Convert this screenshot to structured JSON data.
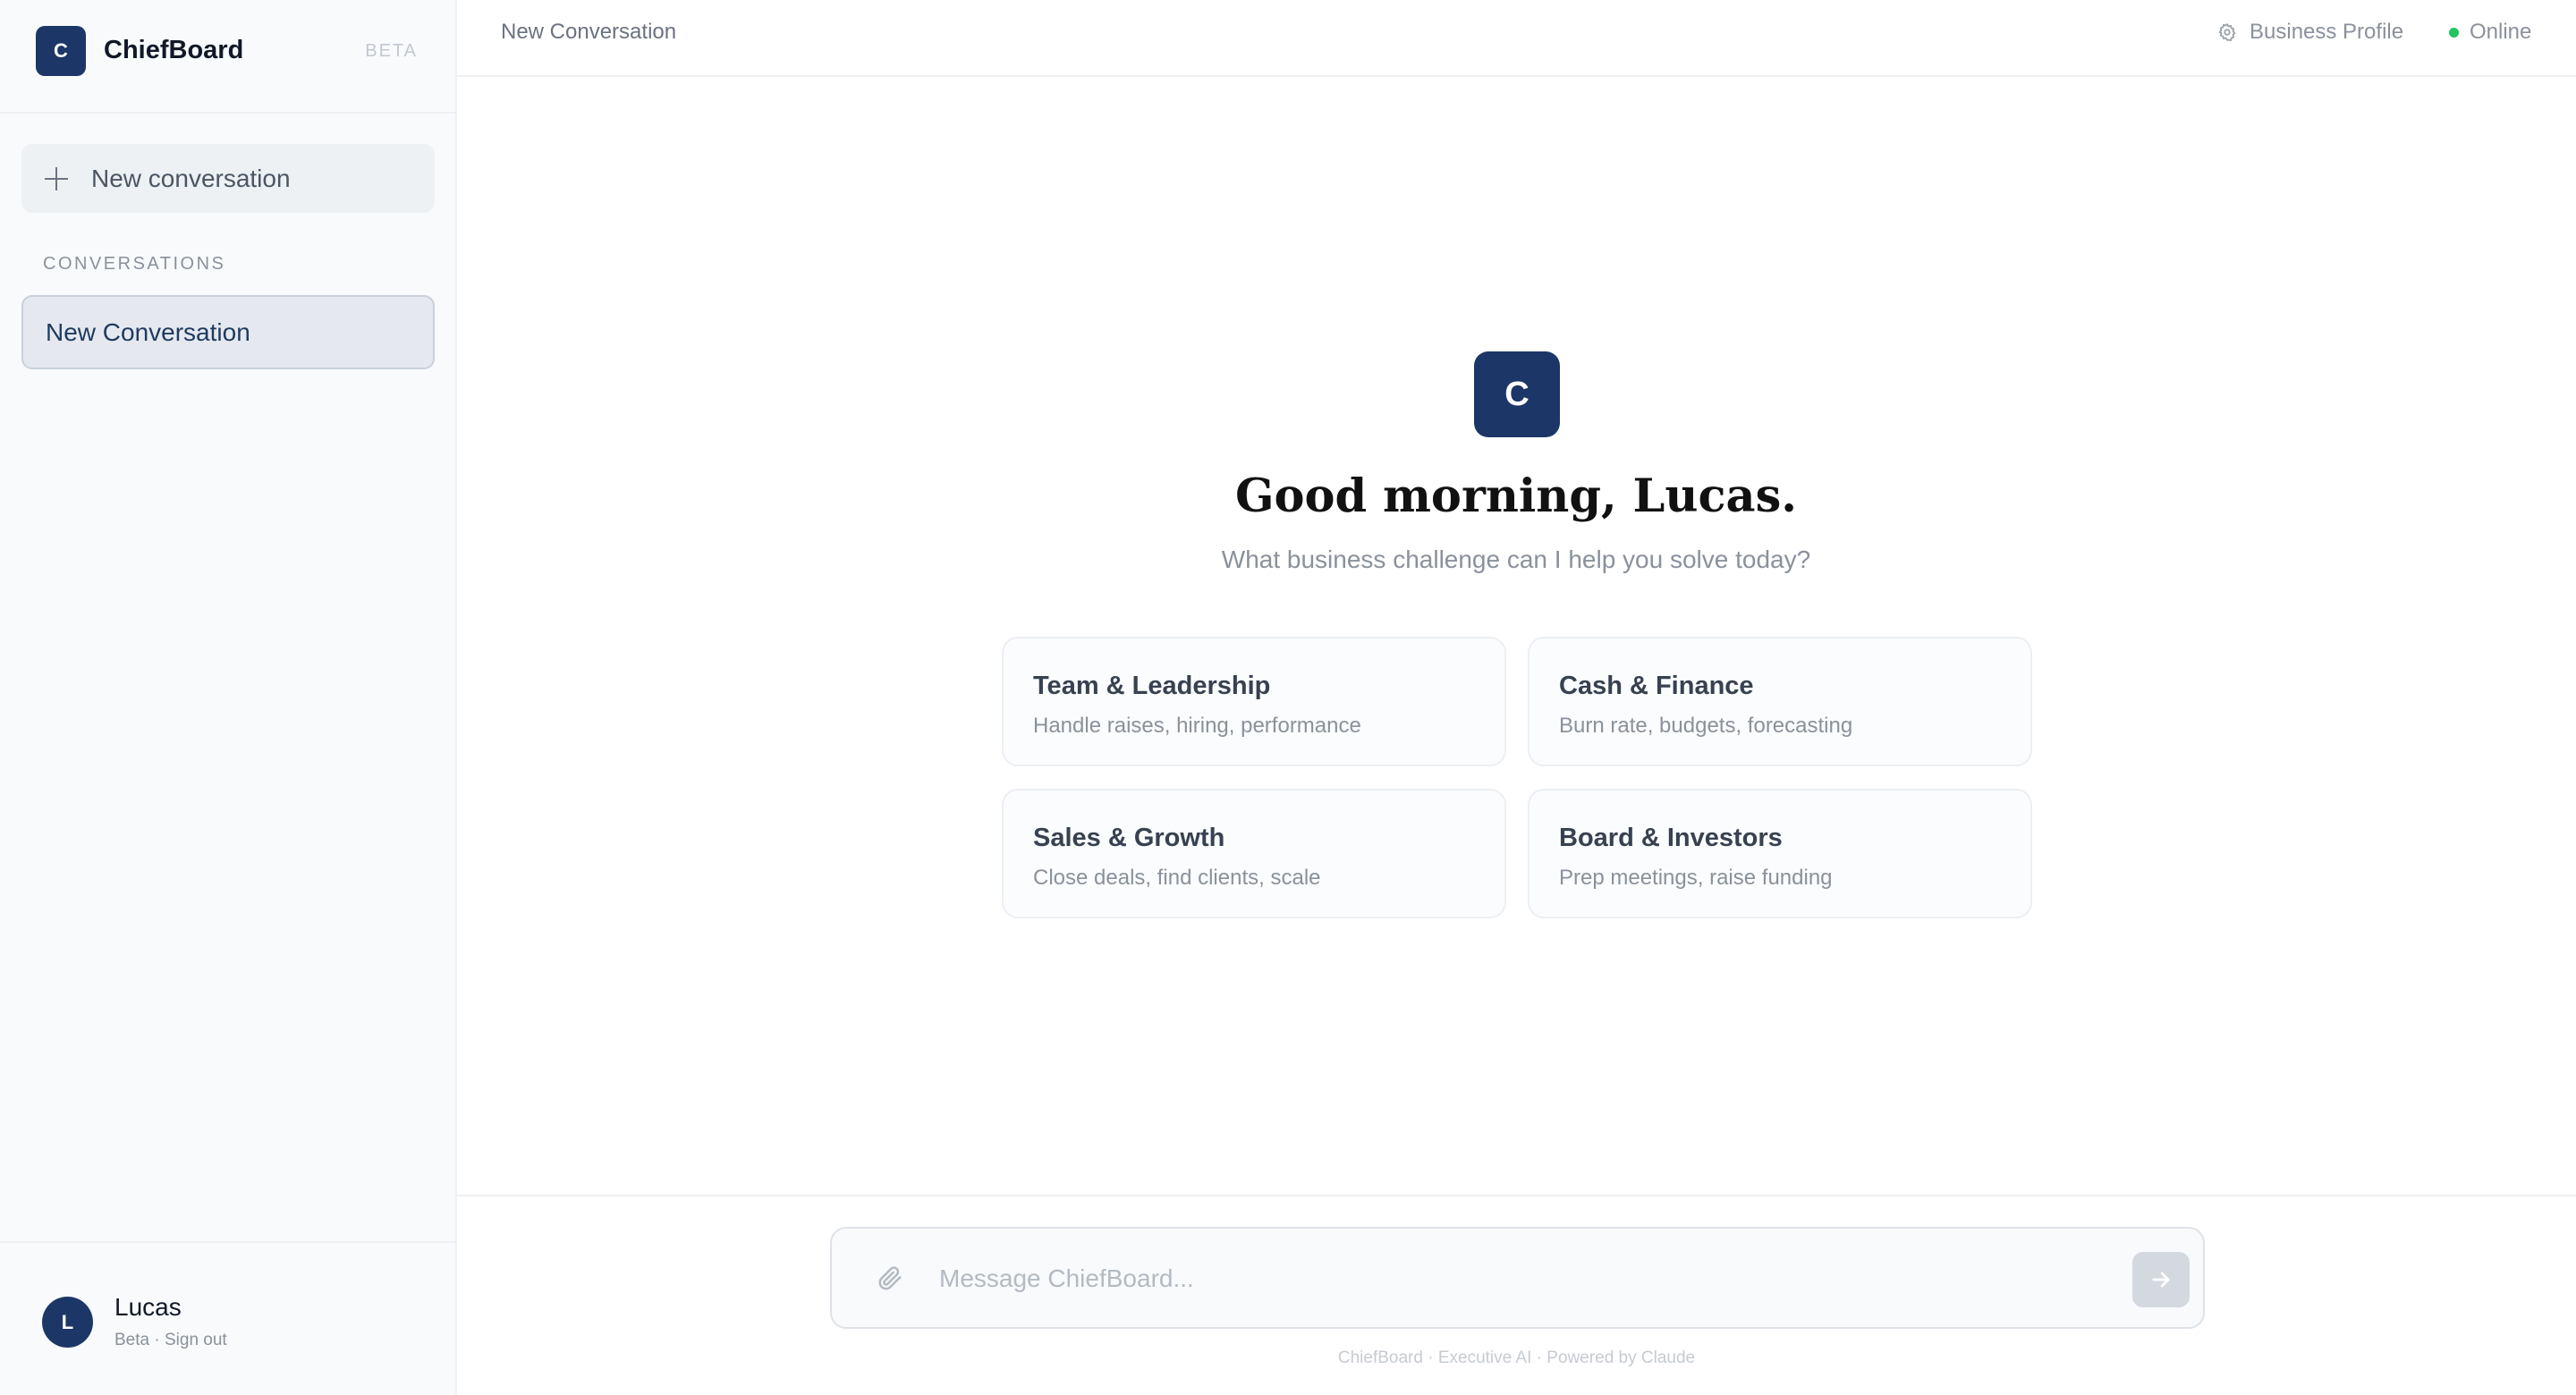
{
  "app": {
    "logo_letter": "C",
    "name": "ChiefBoard",
    "badge": "BETA"
  },
  "sidebar": {
    "new_conversation_label": "New conversation",
    "section_label": "CONVERSATIONS",
    "conversations": [
      {
        "label": "New Conversation",
        "active": true
      }
    ]
  },
  "user": {
    "avatar_letter": "L",
    "name": "Lucas",
    "plan": "Beta",
    "separator": " · ",
    "signout_label": "Sign out"
  },
  "topbar": {
    "conversation_title": "New Conversation",
    "profile_label": "Business Profile",
    "profile_icon": "gear-icon",
    "status_label": "Online",
    "status_color": "#22c55e"
  },
  "hero": {
    "logo_letter": "C",
    "greeting": "Good morning, Lucas.",
    "subtitle": "What business challenge can I help you solve today?"
  },
  "cards": [
    {
      "title": "Team & Leadership",
      "description": "Handle raises, hiring, performance"
    },
    {
      "title": "Cash & Finance",
      "description": "Burn rate, budgets, forecasting"
    },
    {
      "title": "Sales & Growth",
      "description": "Close deals, find clients, scale"
    },
    {
      "title": "Board & Investors",
      "description": "Prep meetings, raise funding"
    }
  ],
  "composer": {
    "placeholder": "Message ChiefBoard...",
    "value": "",
    "attach_icon": "paperclip-icon",
    "send_icon": "arrow-right-icon",
    "footer_note": "ChiefBoard · Executive AI · Powered by Claude"
  },
  "colors": {
    "brand": "#1c3767",
    "sidebar_bg": "#f8fafc",
    "active_item_bg": "#e5e9ef"
  }
}
